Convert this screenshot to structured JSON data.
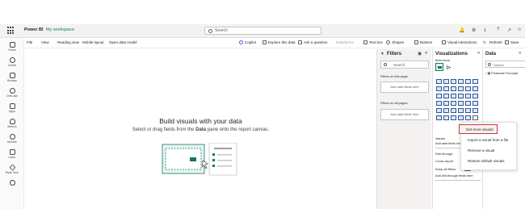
{
  "app": {
    "name": "Power BI",
    "workspace": "My workspace"
  },
  "search": {
    "placeholder": "Search"
  },
  "ribbon": {
    "file": "File",
    "view": "View",
    "reading_view": "Reading view",
    "mobile_layout": "Mobile layout",
    "open_data_model": "Open data model",
    "copilot": "Copilot",
    "explore_data": "Explore this data",
    "ask_question": "Ask a question",
    "dataverse": "Data/arrive",
    "text_box": "Text box",
    "shapes": "Shapes",
    "buttons": "Buttons",
    "visual_interactions": "Visual interactions",
    "refresh": "Refresh",
    "save": "Save"
  },
  "leftnav": [
    "Home",
    "Create",
    "Browse",
    "OneLake",
    "Apps",
    "Metrics",
    "Monitor",
    "Learn",
    "Real-Time",
    ""
  ],
  "canvas": {
    "title": "Build visuals with your data",
    "subtitle_pre": "Select or drag fields from the ",
    "subtitle_bold": "Data",
    "subtitle_post": " pane onto the report canvas."
  },
  "filters": {
    "title": "Filters",
    "search_placeholder": "Search",
    "on_this_page": "Filters on this page",
    "on_all_pages": "Filters on all pages",
    "drop_here": "Add data fields here"
  },
  "visualizations": {
    "title": "Visualizations",
    "build_visual": "Build visual",
    "values": "Values",
    "add_fields": "Add data fields her",
    "drill_through": "Drill through",
    "cross_report": "Cross-report",
    "keep_all_filters": "Keep all filters",
    "add_drill": "Add drill-through fields here"
  },
  "menu": {
    "items": [
      "Get more visuals",
      "Import a visual from a file",
      "Remove a visual",
      "Restore default visuals"
    ],
    "highlighted_color": "#d13438"
  },
  "data_pane": {
    "title": "Data",
    "search_placeholder": "Search",
    "table_item": "Financial Forecast"
  },
  "colors": {
    "accent": "#117865",
    "highlight": "#d13438"
  }
}
